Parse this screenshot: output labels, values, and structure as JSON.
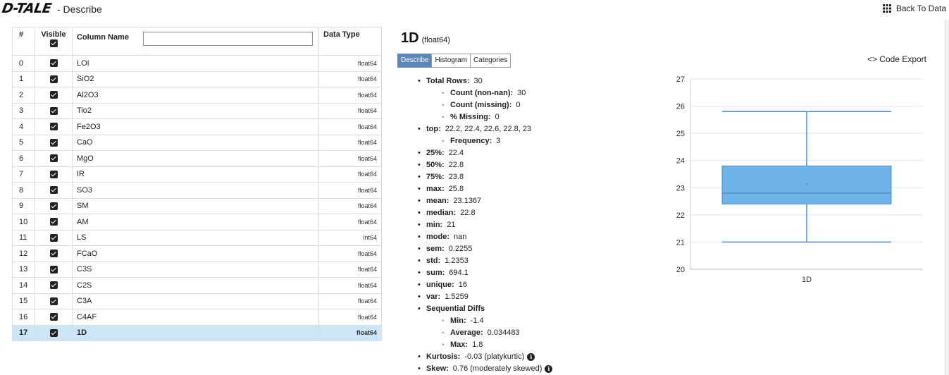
{
  "header": {
    "logo_text": "D-TALE",
    "title": "- Describe",
    "back_label": "Back To Data",
    "back_icon": "grid-icon"
  },
  "columns_table": {
    "headers": {
      "num": "#",
      "visible": "Visible",
      "name": "Column Name",
      "type": "Data Type"
    },
    "filter_value": "",
    "rows": [
      {
        "num": "0",
        "name": "LOI",
        "type": "float64",
        "visible": true
      },
      {
        "num": "1",
        "name": "SiO2",
        "type": "float64",
        "visible": true
      },
      {
        "num": "2",
        "name": "Al2O3",
        "type": "float64",
        "visible": true
      },
      {
        "num": "3",
        "name": "Tio2",
        "type": "float64",
        "visible": true
      },
      {
        "num": "4",
        "name": "Fe2O3",
        "type": "float64",
        "visible": true
      },
      {
        "num": "5",
        "name": "CaO",
        "type": "float64",
        "visible": true
      },
      {
        "num": "6",
        "name": "MgO",
        "type": "float64",
        "visible": true
      },
      {
        "num": "7",
        "name": "IR",
        "type": "float64",
        "visible": true
      },
      {
        "num": "8",
        "name": "SO3",
        "type": "float64",
        "visible": true
      },
      {
        "num": "9",
        "name": "SM",
        "type": "float64",
        "visible": true
      },
      {
        "num": "10",
        "name": "AM",
        "type": "float64",
        "visible": true
      },
      {
        "num": "11",
        "name": "LS",
        "type": "int64",
        "visible": true
      },
      {
        "num": "12",
        "name": "FCaO",
        "type": "float64",
        "visible": true
      },
      {
        "num": "13",
        "name": "C3S",
        "type": "float64",
        "visible": true
      },
      {
        "num": "14",
        "name": "C2S",
        "type": "float64",
        "visible": true
      },
      {
        "num": "15",
        "name": "C3A",
        "type": "float64",
        "visible": true
      },
      {
        "num": "16",
        "name": "C4AF",
        "type": "float64",
        "visible": true
      },
      {
        "num": "17",
        "name": "1D",
        "type": "float64",
        "visible": true,
        "selected": true
      }
    ]
  },
  "detail": {
    "column": "1D",
    "dtype": "(float64)",
    "tabs": [
      {
        "label": "Describe",
        "active": true
      },
      {
        "label": "Histogram",
        "active": false
      },
      {
        "label": "Categories",
        "active": false
      }
    ],
    "code_export_label": "Code Export",
    "stats": {
      "total_rows": {
        "label": "Total Rows:",
        "value": "30"
      },
      "count_nonnan": {
        "label": "Count (non-nan):",
        "value": "30"
      },
      "count_missing": {
        "label": "Count (missing):",
        "value": "0"
      },
      "pct_missing": {
        "label": "% Missing:",
        "value": "0"
      },
      "top": {
        "label": "top:",
        "value": "22.2, 22.4, 22.6, 22.8, 23"
      },
      "frequency": {
        "label": "Frequency:",
        "value": "3"
      },
      "p25": {
        "label": "25%:",
        "value": "22.4"
      },
      "p50": {
        "label": "50%:",
        "value": "22.8"
      },
      "p75": {
        "label": "75%:",
        "value": "23.8"
      },
      "max": {
        "label": "max:",
        "value": "25.8"
      },
      "mean": {
        "label": "mean:",
        "value": "23.1367"
      },
      "median": {
        "label": "median:",
        "value": "22.8"
      },
      "min": {
        "label": "min:",
        "value": "21"
      },
      "mode": {
        "label": "mode:",
        "value": "nan"
      },
      "sem": {
        "label": "sem:",
        "value": "0.2255"
      },
      "std": {
        "label": "std:",
        "value": "1.2353"
      },
      "sum": {
        "label": "sum:",
        "value": "694.1"
      },
      "unique": {
        "label": "unique:",
        "value": "16"
      },
      "var": {
        "label": "var:",
        "value": "1.5259"
      },
      "seq_diffs": {
        "label": "Sequential Diffs"
      },
      "seq_min": {
        "label": "Min:",
        "value": "-1.4"
      },
      "seq_avg": {
        "label": "Average:",
        "value": "0.034483"
      },
      "seq_max": {
        "label": "Max:",
        "value": "1.8"
      },
      "kurtosis": {
        "label": "Kurtosis:",
        "value": "-0.03 (platykurtic)"
      },
      "skew": {
        "label": "Skew:",
        "value": "0.76 (moderately skewed)"
      }
    }
  },
  "chart_data": {
    "type": "box",
    "categories": [
      "1D"
    ],
    "box": {
      "min": 21,
      "q1": 22.4,
      "median": 22.8,
      "q3": 23.8,
      "max": 25.8,
      "mean": 23.1367
    },
    "ylim": [
      20,
      27
    ],
    "yticks": [
      20,
      21,
      22,
      23,
      24,
      25,
      26,
      27
    ],
    "grid": true,
    "colors": {
      "box_fill": "#6fb3ea",
      "box_stroke": "#4a8fcf",
      "grid": "#e3e3e3"
    }
  }
}
